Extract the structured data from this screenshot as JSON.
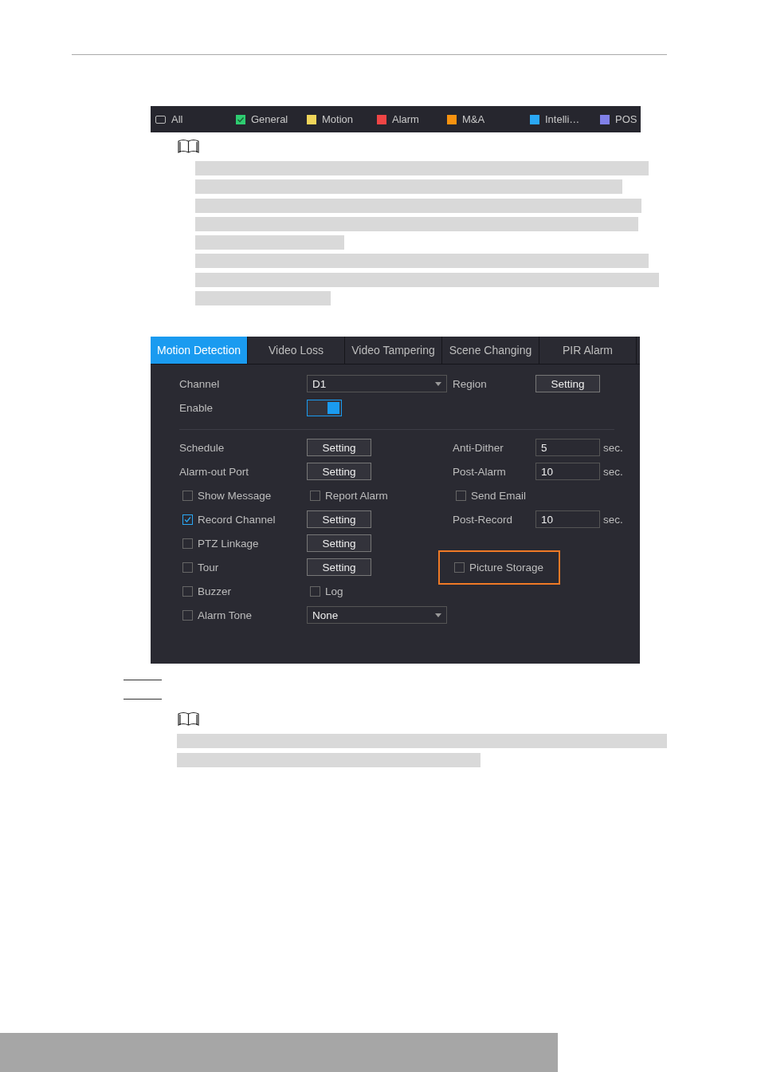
{
  "legend": [
    {
      "kind": "all",
      "label": "All"
    },
    {
      "kind": "swatch",
      "label": "General",
      "color": "#2ecc71",
      "checked": true
    },
    {
      "kind": "swatch",
      "label": "Motion",
      "color": "#f0d55a",
      "checked": false
    },
    {
      "kind": "swatch",
      "label": "Alarm",
      "color": "#f04545",
      "checked": false
    },
    {
      "kind": "swatch",
      "label": "M&A",
      "color": "#f7920f",
      "checked": false
    },
    {
      "kind": "swatch",
      "label": "Intelli…",
      "color": "#2aa8f5",
      "checked": false
    },
    {
      "kind": "swatch",
      "label": "POS",
      "color": "#8080e8",
      "checked": false
    }
  ],
  "tabs": [
    {
      "label": "Motion Detection",
      "selected": true
    },
    {
      "label": "Video Loss",
      "selected": false
    },
    {
      "label": "Video Tampering",
      "selected": false
    },
    {
      "label": "Scene Changing",
      "selected": false
    },
    {
      "label": "PIR Alarm",
      "selected": false
    }
  ],
  "form": {
    "sections": [
      [
        {
          "cells": [
            {
              "kind": "label",
              "text": "Channel"
            },
            {
              "kind": "select",
              "value": "D1"
            },
            {
              "kind": "label",
              "text": "Region"
            },
            {
              "kind": "button",
              "label": "Setting"
            }
          ]
        },
        {
          "cells": [
            {
              "kind": "label",
              "text": "Enable"
            },
            {
              "kind": "toggle",
              "on": true
            }
          ]
        }
      ],
      [
        {
          "cells": [
            {
              "kind": "label",
              "text": "Schedule"
            },
            {
              "kind": "button",
              "label": "Setting"
            },
            {
              "kind": "label",
              "text": "Anti-Dither"
            },
            {
              "kind": "input",
              "value": "5",
              "unit": "sec."
            }
          ]
        },
        {
          "cells": [
            {
              "kind": "label",
              "text": "Alarm-out Port"
            },
            {
              "kind": "button",
              "label": "Setting"
            },
            {
              "kind": "label",
              "text": "Post-Alarm"
            },
            {
              "kind": "input",
              "value": "10",
              "unit": "sec."
            }
          ]
        },
        {
          "cells": [
            {
              "kind": "checkbox",
              "label": "Show Message",
              "checked": false,
              "highlighted": false
            },
            {
              "kind": "checkbox",
              "label": "Report Alarm",
              "checked": false,
              "highlighted": false
            },
            {
              "kind": "checkbox",
              "label": "Send Email",
              "checked": false,
              "highlighted": false
            }
          ]
        },
        {
          "cells": [
            {
              "kind": "checkbox",
              "label": "Record Channel",
              "checked": true,
              "highlighted": false
            },
            {
              "kind": "button",
              "label": "Setting"
            },
            {
              "kind": "label",
              "text": "Post-Record"
            },
            {
              "kind": "input",
              "value": "10",
              "unit": "sec."
            }
          ]
        },
        {
          "cells": [
            {
              "kind": "checkbox",
              "label": "PTZ Linkage",
              "checked": false,
              "highlighted": false
            },
            {
              "kind": "button",
              "label": "Setting"
            }
          ]
        },
        {
          "cells": [
            {
              "kind": "checkbox",
              "label": "Tour",
              "checked": false,
              "highlighted": false
            },
            {
              "kind": "button",
              "label": "Setting"
            },
            {
              "kind": "checkbox",
              "label": "Picture Storage",
              "checked": false,
              "highlighted": true
            }
          ]
        },
        {
          "cells": [
            {
              "kind": "checkbox",
              "label": "Buzzer",
              "checked": false,
              "highlighted": false
            },
            {
              "kind": "checkbox",
              "label": "Log",
              "checked": false,
              "highlighted": false
            }
          ]
        },
        {
          "cells": [
            {
              "kind": "checkbox",
              "label": "Alarm Tone",
              "checked": false,
              "highlighted": false
            },
            {
              "kind": "select",
              "value": "None"
            }
          ]
        }
      ]
    ]
  }
}
